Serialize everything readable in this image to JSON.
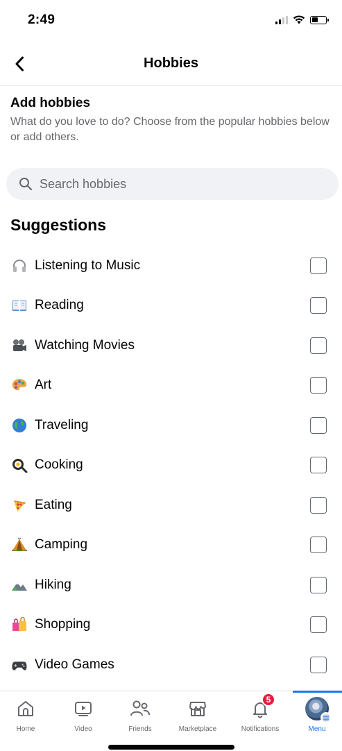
{
  "status_bar": {
    "time": "2:49"
  },
  "header": {
    "title": "Hobbies"
  },
  "intro": {
    "title": "Add hobbies",
    "description": "What do you love to do? Choose from the popular hobbies below or add others."
  },
  "search": {
    "placeholder": "Search hobbies",
    "value": ""
  },
  "suggestions": {
    "title": "Suggestions",
    "items": [
      {
        "label": "Listening to Music",
        "icon": "headphones-icon",
        "checked": false
      },
      {
        "label": "Reading",
        "icon": "book-icon",
        "checked": false
      },
      {
        "label": "Watching Movies",
        "icon": "film-camera-icon",
        "checked": false
      },
      {
        "label": "Art",
        "icon": "palette-icon",
        "checked": false
      },
      {
        "label": "Traveling",
        "icon": "globe-icon",
        "checked": false
      },
      {
        "label": "Cooking",
        "icon": "frying-pan-icon",
        "checked": false
      },
      {
        "label": "Eating",
        "icon": "pizza-icon",
        "checked": false
      },
      {
        "label": "Camping",
        "icon": "tent-icon",
        "checked": false
      },
      {
        "label": "Hiking",
        "icon": "mountain-icon",
        "checked": false
      },
      {
        "label": "Shopping",
        "icon": "shopping-bags-icon",
        "checked": false
      },
      {
        "label": "Video Games",
        "icon": "game-controller-icon",
        "checked": false
      }
    ]
  },
  "tab_bar": {
    "tabs": [
      {
        "label": "Home",
        "icon": "home-icon"
      },
      {
        "label": "Video",
        "icon": "video-icon"
      },
      {
        "label": "Friends",
        "icon": "friends-icon"
      },
      {
        "label": "Marketplace",
        "icon": "marketplace-icon"
      },
      {
        "label": "Notifications",
        "icon": "bell-icon",
        "badge": "5"
      },
      {
        "label": "Menu",
        "icon": "avatar",
        "active": true
      }
    ]
  },
  "colors": {
    "accent": "#1877f2",
    "badge": "#e41e3f",
    "secondary_text": "#65676b",
    "search_bg": "#f0f2f5"
  }
}
